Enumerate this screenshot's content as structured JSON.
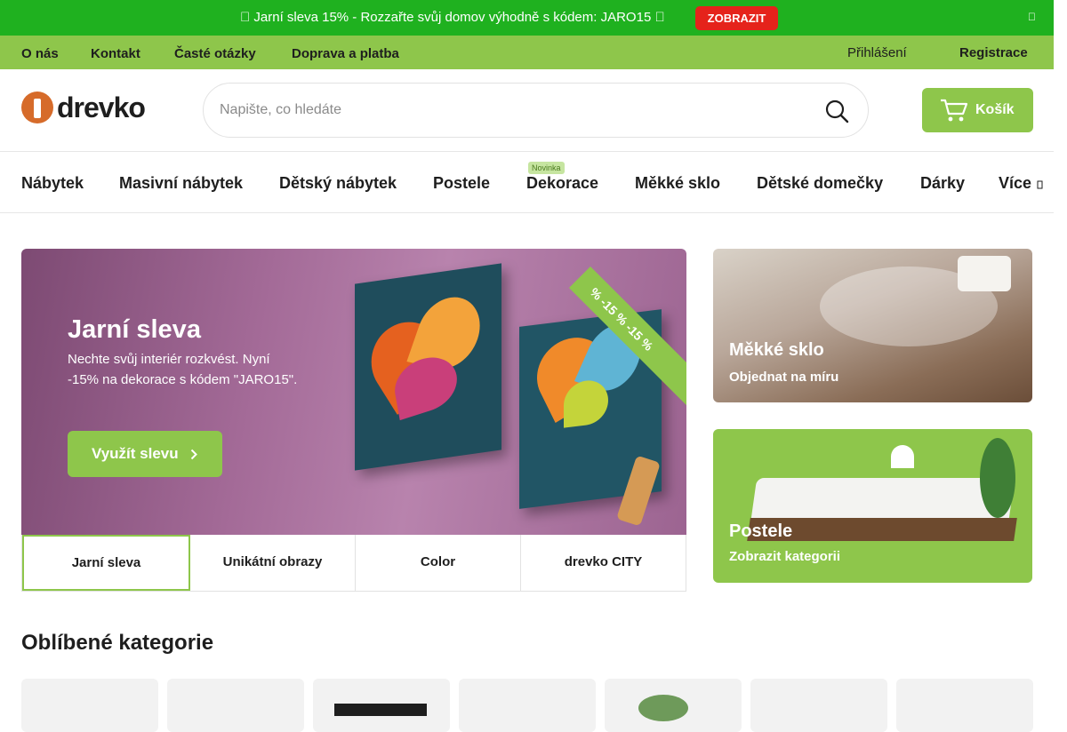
{
  "promo": {
    "text": "\u0000 Jarní sleva 15% - Rozzařte svůj domov výhodně s kódem: JARO15 \u0000",
    "button": "ZOBRAZIT",
    "close": "\u0000"
  },
  "topbar": {
    "links": [
      "O nás",
      "Kontakt",
      "Časté otázky",
      "Doprava a platba"
    ],
    "login": "Přihlášení",
    "register": "Registrace"
  },
  "header": {
    "logo": "drevko",
    "search_placeholder": "Napište, co hledáte",
    "cart_label": "Košík"
  },
  "nav": {
    "items": [
      "Nábytek",
      "Masivní nábytek",
      "Dětský nábytek",
      "Postele",
      "Dekorace",
      "Měkké sklo",
      "Dětské domečky",
      "Dárky",
      "Více"
    ],
    "badge": "Novinka"
  },
  "hero": {
    "title": "Jarní sleva",
    "subtitle": "Nechte svůj interiér rozkvést. Nyní -15% na dekorace s kódem \"JARO15\".",
    "cta": "Využít slevu",
    "ribbon": "%   -15 %   -15 %"
  },
  "tabs": [
    "Jarní sleva",
    "Unikátní obrazy",
    "Color",
    "drevko CITY"
  ],
  "side_banners": [
    {
      "title": "Měkké sklo",
      "subtitle": "Objednat na míru"
    },
    {
      "title": "Postele",
      "subtitle": "Zobrazit kategorii"
    }
  ],
  "categories": {
    "title": "Oblíbené kategorie"
  },
  "colors": {
    "green": "#8ec64b",
    "promo_green": "#1fb11f",
    "red": "#e5231b"
  }
}
